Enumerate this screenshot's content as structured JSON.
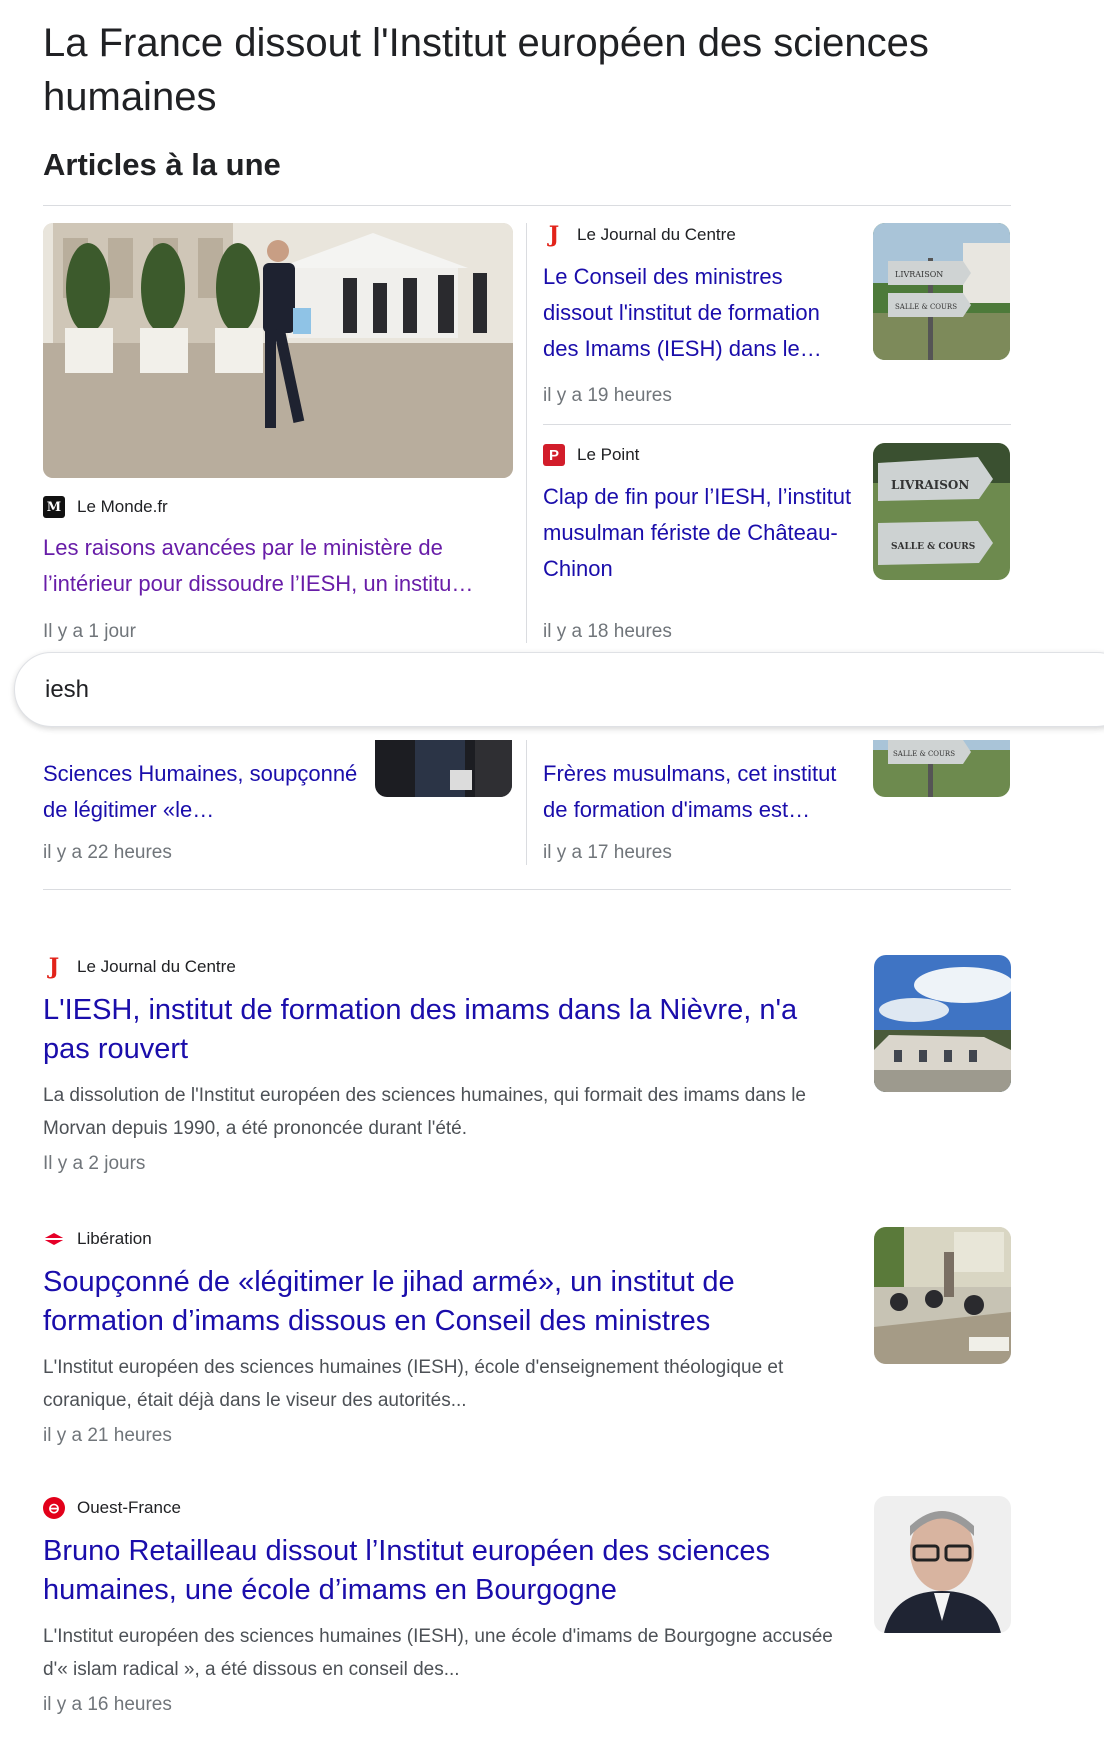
{
  "page_title": "La France dissout l'Institut européen des sciences humaines",
  "section_title": "Articles à la une",
  "search": {
    "value": "iesh"
  },
  "top_stories": {
    "featured": {
      "source": "Le Monde.fr",
      "title": "Les raisons avancées par le ministère de l’intérieur pour dissoudre l’IESH, un institu…",
      "time": "Il y a 1 jour"
    },
    "right1": {
      "source": "Le Journal du Centre",
      "title": "Le Conseil des ministres dissout l'institut de formation des Imams (IESH) dans le…",
      "time": "il y a 19 heures"
    },
    "right2": {
      "source": "Le Point",
      "title": "Clap de fin pour l’IESH, l’institut musulman fériste de Château-Chinon",
      "time": "il y a 18 heures"
    },
    "bottom_left": {
      "title": "Sciences Humaines, soupçonné de légitimer «le…",
      "time": "il y a 22 heures"
    },
    "bottom_right": {
      "title": "Frères musulmans, cet institut de formation d'imams est…",
      "time": "il y a 17 heures"
    }
  },
  "results": [
    {
      "source": "Le Journal du Centre",
      "title": "L'IESH, institut de formation des imams dans la Nièvre, n'a pas rouvert",
      "snippet": "La dissolution de l'Institut européen des sciences humaines, qui formait des imams dans le Morvan depuis 1990, a été prononcée durant l'été.",
      "time": "Il y a 2 jours"
    },
    {
      "source": "Libération",
      "title": "Soupçonné de «légitimer le jihad armé», un institut de formation d’imams dissous en Conseil des ministres",
      "snippet": "L'Institut européen des sciences humaines (IESH), école d'enseignement théologique et coranique, était déjà dans le viseur des autorités...",
      "time": "il y a 21 heures"
    },
    {
      "source": "Ouest-France",
      "title": "Bruno Retailleau dissout l’Institut européen des sciences humaines, une école d’imams en Bourgogne",
      "snippet": "L'Institut européen des sciences humaines (IESH), une école d'imams de Bourgogne accusée d'« islam radical », a été dissous en conseil des...",
      "time": "il y a 16 heures"
    }
  ],
  "logos": {
    "monde": "M",
    "jdc": "J",
    "point": "P",
    "ouest": "⊖"
  },
  "sign_texts": {
    "livraison": "LIVRAISON",
    "salle": "SALLE & COURS"
  }
}
